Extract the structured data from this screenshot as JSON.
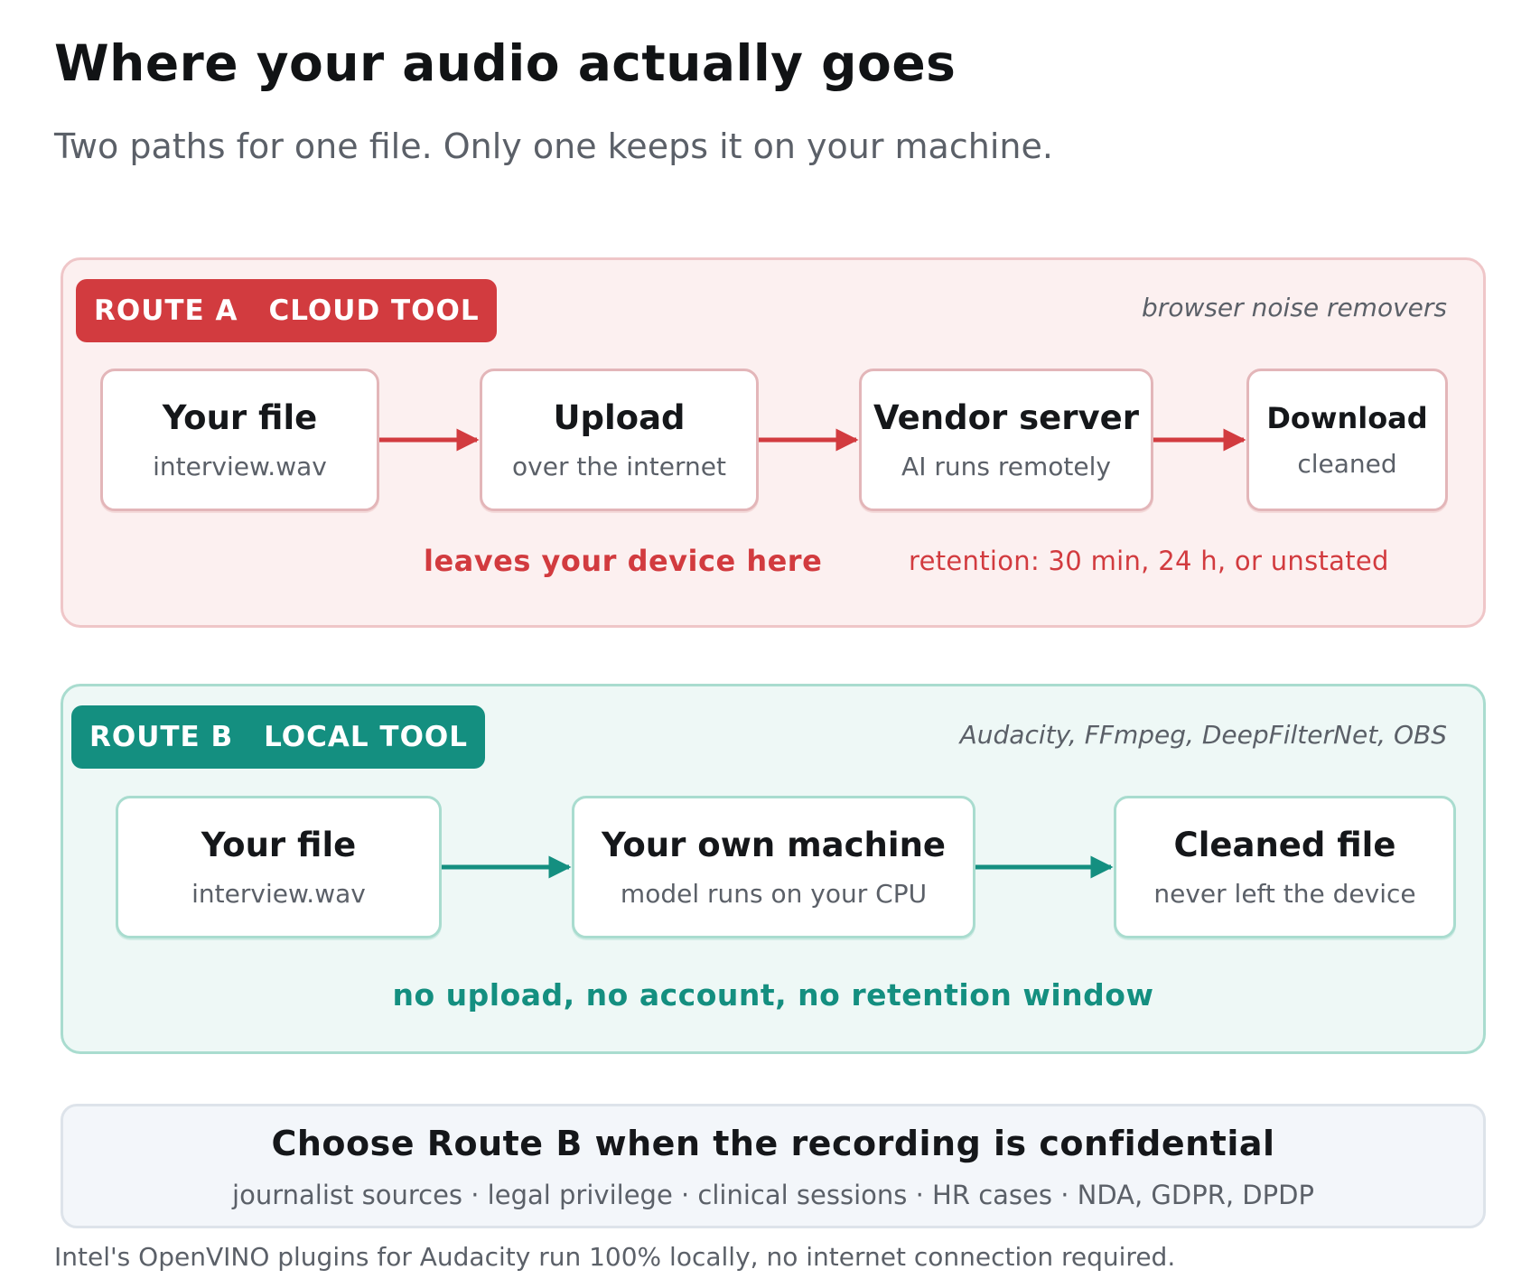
{
  "header": {
    "title": "Where your audio actually goes",
    "subtitle": "Two paths for one file. Only one keeps it on your machine."
  },
  "colors": {
    "route_a_accent": "#d23b3f",
    "route_a_background": "#fcf0f0",
    "route_b_accent": "#148f80",
    "route_b_background": "#eef8f6",
    "text_muted": "#5b6068"
  },
  "route_a": {
    "badge_route": "ROUTE A",
    "badge_label": "CLOUD TOOL",
    "examples": "browser noise removers",
    "steps": [
      {
        "title": "Your file",
        "subtitle": "interview.wav"
      },
      {
        "title": "Upload",
        "subtitle": "over the internet"
      },
      {
        "title": "Vendor server",
        "subtitle": "AI runs remotely"
      },
      {
        "title": "Download",
        "subtitle": "cleaned"
      }
    ],
    "warning": "leaves your device here",
    "retention": "retention: 30 min, 24 h, or unstated"
  },
  "route_b": {
    "badge_route": "ROUTE B",
    "badge_label": "LOCAL TOOL",
    "examples": "Audacity, FFmpeg, DeepFilterNet, OBS",
    "steps": [
      {
        "title": "Your file",
        "subtitle": "interview.wav"
      },
      {
        "title": "Your own machine",
        "subtitle": "model runs on your CPU"
      },
      {
        "title": "Cleaned file",
        "subtitle": "never left the device"
      }
    ],
    "benefit": "no upload, no account, no retention window"
  },
  "recommendation": {
    "title": "Choose Route B when the recording is confidential",
    "use_cases": "journalist sources · legal privilege · clinical sessions · HR cases · NDA, GDPR, DPDP"
  },
  "footer": {
    "note": "Intel's OpenVINO plugins for Audacity run 100% locally, no internet connection required."
  }
}
